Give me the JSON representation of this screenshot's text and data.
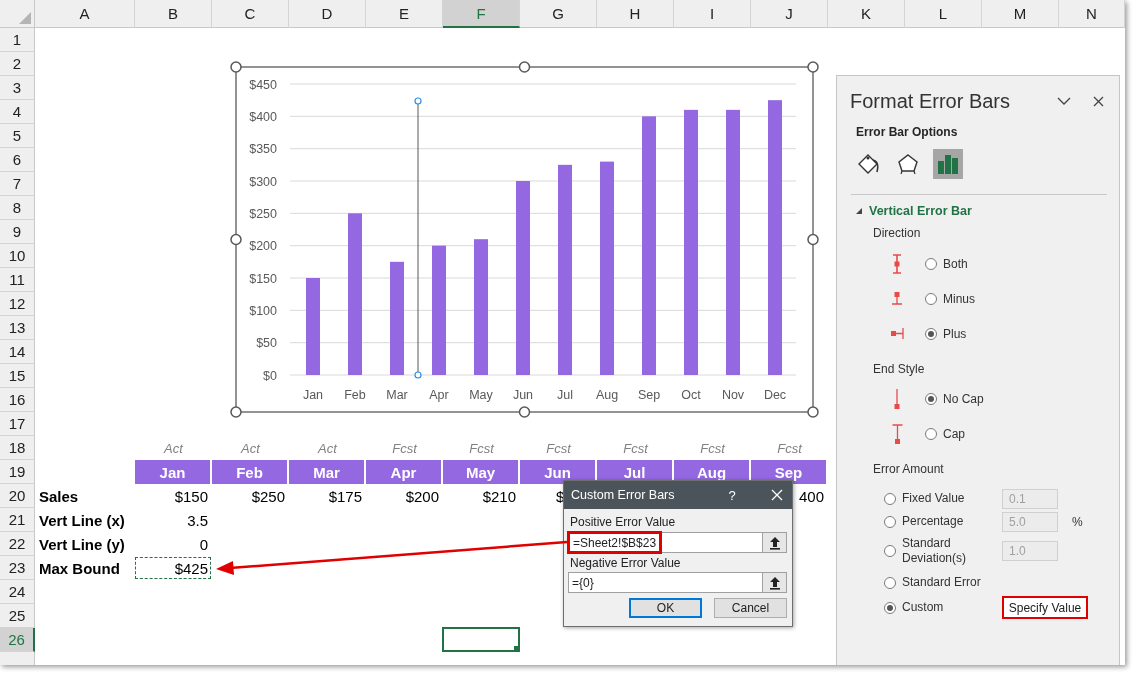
{
  "sheet": {
    "columns": [
      {
        "label": "A",
        "selected": false
      },
      {
        "label": "B",
        "selected": false
      },
      {
        "label": "C",
        "selected": false
      },
      {
        "label": "D",
        "selected": false
      },
      {
        "label": "E",
        "selected": false
      },
      {
        "label": "F",
        "selected": true
      },
      {
        "label": "G",
        "selected": false
      },
      {
        "label": "H",
        "selected": false
      },
      {
        "label": "I",
        "selected": false
      },
      {
        "label": "J",
        "selected": false
      },
      {
        "label": "K",
        "selected": false
      },
      {
        "label": "L",
        "selected": false
      },
      {
        "label": "M",
        "selected": false
      },
      {
        "label": "N",
        "selected": false
      }
    ],
    "rows": [
      {
        "label": "1",
        "selected": false
      },
      {
        "label": "2",
        "selected": false
      },
      {
        "label": "3",
        "selected": false
      },
      {
        "label": "4",
        "selected": false
      },
      {
        "label": "5",
        "selected": false
      },
      {
        "label": "6",
        "selected": false
      },
      {
        "label": "7",
        "selected": false
      },
      {
        "label": "8",
        "selected": false
      },
      {
        "label": "9",
        "selected": false
      },
      {
        "label": "10",
        "selected": false
      },
      {
        "label": "11",
        "selected": false
      },
      {
        "label": "12",
        "selected": false
      },
      {
        "label": "13",
        "selected": false
      },
      {
        "label": "14",
        "selected": false
      },
      {
        "label": "15",
        "selected": false
      },
      {
        "label": "16",
        "selected": false
      },
      {
        "label": "17",
        "selected": false
      },
      {
        "label": "18",
        "selected": false
      },
      {
        "label": "19",
        "selected": false
      },
      {
        "label": "20",
        "selected": false
      },
      {
        "label": "21",
        "selected": false
      },
      {
        "label": "22",
        "selected": false
      },
      {
        "label": "23",
        "selected": false
      },
      {
        "label": "24",
        "selected": false
      },
      {
        "label": "25",
        "selected": false
      },
      {
        "label": "26",
        "selected": true
      }
    ]
  },
  "table": {
    "notes": [
      "Act",
      "Act",
      "Act",
      "Fcst",
      "Fcst",
      "Fcst",
      "Fcst",
      "Fcst",
      "Fcst"
    ],
    "months": [
      "Jan",
      "Feb",
      "Mar",
      "Apr",
      "May",
      "Jun",
      "Jul",
      "Aug",
      "Sep"
    ],
    "rows": [
      {
        "label": "Sales",
        "copied": false,
        "values": [
          {
            "text": "$150"
          },
          {
            "text": "$250"
          },
          {
            "text": "$175"
          },
          {
            "text": "$200"
          },
          {
            "text": "$210"
          },
          {
            "text": "$",
            "cut": true
          }
        ],
        "last": {
          "text": "400"
        }
      },
      {
        "label": "Vert Line (x)",
        "copied": false,
        "values": [
          {
            "text": "3.5"
          }
        ]
      },
      {
        "label": "Vert Line (y)",
        "copied": false,
        "values": [
          {
            "text": "0"
          }
        ]
      },
      {
        "label": "Max Bound",
        "copied": true,
        "values": [
          {
            "text": "$425"
          }
        ]
      }
    ]
  },
  "chart": {
    "chart_data": {
      "type": "bar",
      "grid": true,
      "categories": [
        "Jan",
        "Feb",
        "Mar",
        "Apr",
        "May",
        "Jun",
        "Jul",
        "Aug",
        "Sep",
        "Oct",
        "Nov",
        "Dec"
      ],
      "series": [
        {
          "color": "#9368e0",
          "values": [
            150,
            250,
            175,
            200,
            210,
            300,
            325,
            330,
            400,
            410,
            410,
            425
          ]
        }
      ],
      "ylim": [
        0,
        450
      ],
      "yticks": [
        {
          "value": 0,
          "label": "$0"
        },
        {
          "value": 50,
          "label": "$50"
        },
        {
          "value": 100,
          "label": "$100"
        },
        {
          "value": 150,
          "label": "$150"
        },
        {
          "value": 200,
          "label": "$200"
        },
        {
          "value": 250,
          "label": "$250"
        },
        {
          "value": 300,
          "label": "$300"
        },
        {
          "value": 350,
          "label": "$350"
        },
        {
          "value": 400,
          "label": "$400"
        },
        {
          "value": 450,
          "label": "$450"
        }
      ]
    },
    "selected": true
  },
  "dialog": {
    "title": "Custom Error Bars",
    "help": "?",
    "fields": [
      {
        "label": "Positive Error Value",
        "value": "=Sheet2!$B$23",
        "highlighted": true
      },
      {
        "label": "Negative Error Value",
        "value": "={0}",
        "highlighted": false
      }
    ],
    "buttons": [
      {
        "label": "OK",
        "default": true
      },
      {
        "label": "Cancel",
        "default": false
      }
    ]
  },
  "panel": {
    "title": "Format Error Bars",
    "section": "Error Bar Options",
    "tabs": [
      {
        "kind": "fill",
        "selected": false
      },
      {
        "kind": "effects",
        "selected": false
      },
      {
        "kind": "options",
        "selected": true
      }
    ],
    "group": {
      "title": "Vertical Error Bar",
      "expanded": true,
      "direction": {
        "label": "Direction",
        "options": [
          {
            "label": "Both",
            "kind": "both",
            "selected": false
          },
          {
            "label": "Minus",
            "kind": "minus",
            "selected": false
          },
          {
            "label": "Plus",
            "kind": "plus",
            "selected": true
          }
        ]
      },
      "end_style": {
        "label": "End Style",
        "options": [
          {
            "label": "No Cap",
            "kind": "no_cap",
            "selected": true
          },
          {
            "label": "Cap",
            "kind": "cap",
            "selected": false
          }
        ]
      },
      "error_amount": {
        "label": "Error Amount",
        "options": [
          {
            "label": "Fixed Value",
            "selected": false,
            "value": "0.1",
            "disabled": true
          },
          {
            "label": "Percentage",
            "selected": false,
            "value": "5.0",
            "unit": "%",
            "disabled": true
          },
          {
            "label": "Standard Deviation(s)",
            "selected": false,
            "value": "1.0",
            "disabled": true
          },
          {
            "label": "Standard Error",
            "selected": false
          },
          {
            "label": "Custom",
            "selected": true,
            "button": "Specify Value",
            "highlighted": true
          }
        ]
      }
    }
  }
}
